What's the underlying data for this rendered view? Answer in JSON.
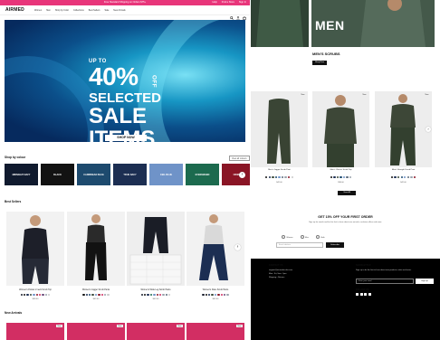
{
  "left": {
    "promo": {
      "message": "Free Standard Shipping on Orders $75+",
      "links": [
        "Help",
        "Find a Store",
        "Sign In"
      ]
    },
    "logo": "AIRMED",
    "nav": [
      "Women",
      "Men",
      "Shop by Color",
      "Collections",
      "Best Sellers",
      "Sale",
      "New Arrivals"
    ],
    "hero": {
      "line1": "UP TO",
      "line2": "40%",
      "line2b": "OFF",
      "line3": "SELECTED",
      "line4": "SALE",
      "line5": "ITEMS",
      "cta": "SHOP NOW"
    },
    "shop_by_color": {
      "title": "Shop by colour",
      "view_all": "View all colours",
      "swatches": [
        {
          "label": "MIDNIGHT NAVY",
          "color": "#101a2e"
        },
        {
          "label": "BLACK",
          "color": "#121212"
        },
        {
          "label": "CARIBBEAN BLUE",
          "color": "#1d4a6e"
        },
        {
          "label": "TRUE NAVY",
          "color": "#1c2e52"
        },
        {
          "label": "CEIL BLUE",
          "color": "#6f93c8"
        },
        {
          "label": "EVERGREEN",
          "color": "#1c6a4e"
        },
        {
          "label": "CRIMSON",
          "color": "#8a1525"
        }
      ]
    },
    "best_sellers": {
      "title": "Best Sellers",
      "products": [
        {
          "name": "Women's Pocket V-neck Scrub Top",
          "price": "$38.00",
          "dots": [
            "#1a1f2e",
            "#101010",
            "#1c2e52",
            "#3a4a3a",
            "#6f93c8",
            "#8a1525",
            "#d22e63",
            "#6a4b7a",
            "#9aa3ad",
            "#c9c9c9"
          ]
        },
        {
          "name": "Women's Jogger Scrub Pants",
          "price": "$42.00",
          "dots": [
            "#101010",
            "#1c2e52",
            "#1d4a6e",
            "#3a4a3a",
            "#6f93c8",
            "#8a1525",
            "#d22e63",
            "#9aa3ad",
            "#c9c9c9"
          ]
        },
        {
          "name": "Women's Wide Leg Scrub Pants",
          "price": "$42.00",
          "dots": [
            "#1a1f2e",
            "#101010",
            "#1c2e52",
            "#1c6a4e",
            "#6f93c8",
            "#8a1525",
            "#d22e63",
            "#9aa3ad",
            "#5b6b7a",
            "#c9c9c9"
          ]
        },
        {
          "name": "Women's Flare Scrub Pants",
          "price": "$42.00",
          "dots": [
            "#1a1f2e",
            "#101010",
            "#1c2e52",
            "#3a4a3a",
            "#6f93c8",
            "#8a1525",
            "#d22e63",
            "#6a4b7a",
            "#9aa3ad"
          ]
        }
      ]
    },
    "new_arrivals": {
      "title": "New Arrivals",
      "badge": "New"
    }
  },
  "right": {
    "men_tile": {
      "word": "MEN"
    },
    "men_scrubs": {
      "title": "MEN'S SCRUBS",
      "cta": "Shop Now"
    },
    "products": [
      {
        "name": "Men's Jogger Scrub Pant",
        "price": "$42.00",
        "badge": "New",
        "dots": [
          "#101010",
          "#1c2e52",
          "#3a4a3a",
          "#1d4a6e",
          "#6f93c8",
          "#5b6b7a",
          "#9aa3ad",
          "#8a1525",
          "#c9c9c9"
        ]
      },
      {
        "name": "Men's Classic Scrub Top",
        "price": "$38.00",
        "badge": "New",
        "dots": [
          "#101010",
          "#1c2e52",
          "#3a4a3a",
          "#1d4a6e",
          "#6f93c8",
          "#5b6b7a",
          "#9aa3ad"
        ]
      },
      {
        "name": "Men's Straight Scrub Pant",
        "price": "$42.00",
        "badge": "New",
        "dots": [
          "#101010",
          "#1c2e52",
          "#3a4a3a",
          "#1d4a6e",
          "#6f93c8",
          "#5b6b7a",
          "#9aa3ad",
          "#8a1525"
        ]
      }
    ],
    "view_all": "View All",
    "newsletter": {
      "title": "GET 15% OFF YOUR FIRST ORDER",
      "subtitle": "Sign up for emails and be the first to hear about new arrivals, exclusive offers and more.",
      "options": [
        "Women",
        "Men",
        "Both"
      ],
      "placeholder": "Email address",
      "cta": "Subscribe"
    },
    "footer": {
      "contact_title": "CONTACT US",
      "contact_lines": [
        "support@airmedscrubs.com",
        "Mon - Fri, 9am - 5pm",
        "Shipping • Returns"
      ],
      "news_title": "NEWSLETTER",
      "news_text": "Sign up to be the first to hear about new products, sales and more.",
      "placeholder": "Enter your email",
      "cta": "Sign up",
      "follow": "FOLLOW US"
    }
  }
}
